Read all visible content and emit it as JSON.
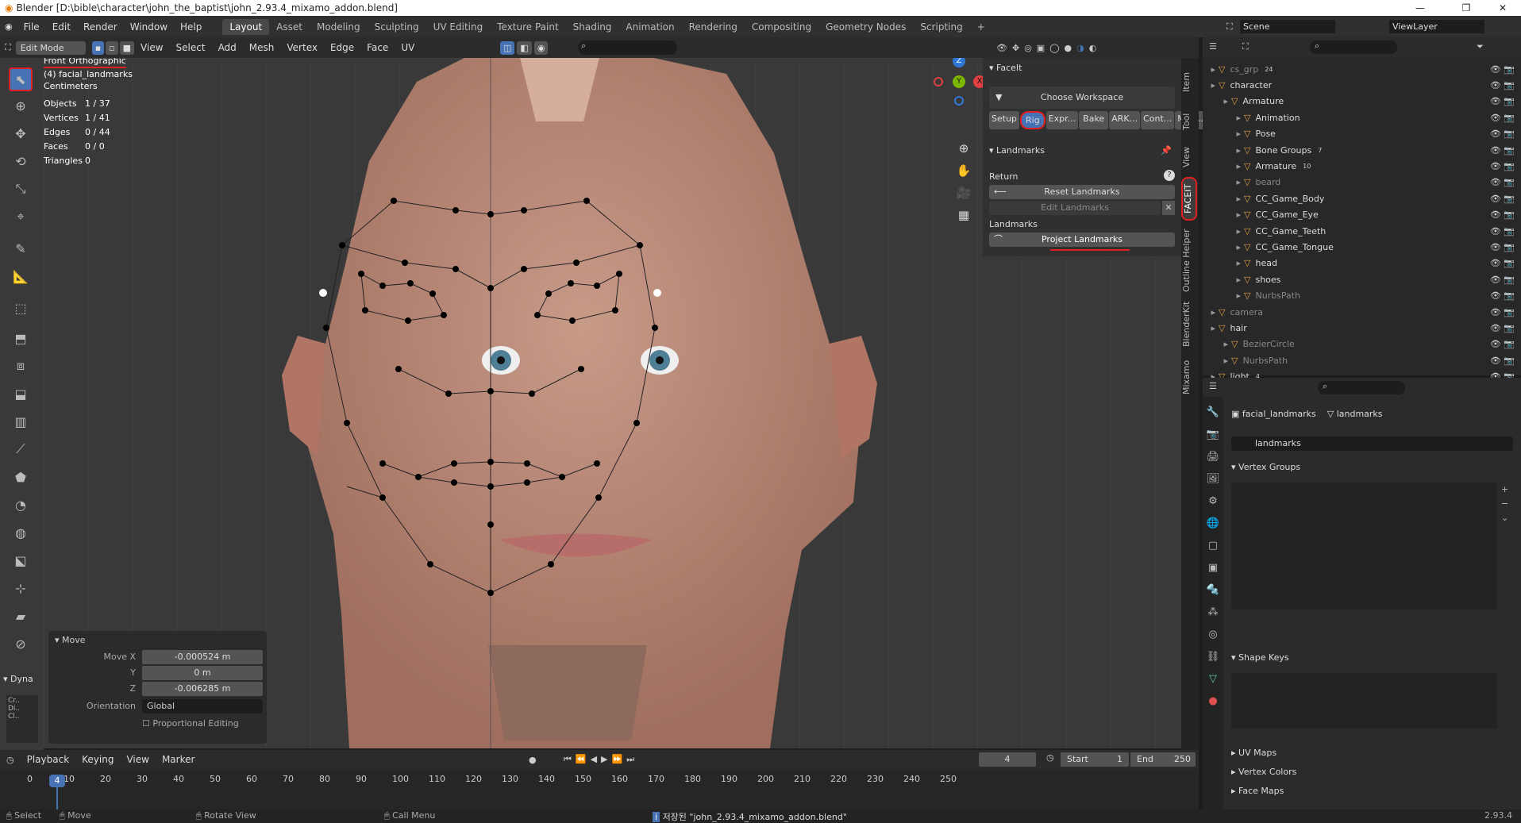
{
  "title": "Blender [D:\\bible\\character\\john_the_baptist\\john_2.93.4_mixamo_addon.blend]",
  "menus": [
    "File",
    "Edit",
    "Render",
    "Window",
    "Help"
  ],
  "workspaces": [
    "Layout",
    "Asset",
    "Modeling",
    "Sculpting",
    "UV Editing",
    "Texture Paint",
    "Shading",
    "Animation",
    "Rendering",
    "Compositing",
    "Geometry Nodes",
    "Scripting"
  ],
  "scene": "Scene",
  "view_layer": "ViewLayer",
  "header": {
    "mode": "Edit Mode",
    "view": "View",
    "select": "Select",
    "add": "Add",
    "mesh": "Mesh",
    "vertex": "Vertex",
    "edge": "Edge",
    "face": "Face",
    "uv": "UV"
  },
  "overlay": {
    "view_name": "Front Orthographic",
    "object": "(4) facial_landmarks",
    "units": "Centimeters",
    "stats": [
      [
        "Objects",
        "1 / 37"
      ],
      [
        "Vertices",
        "1 / 41"
      ],
      [
        "Edges",
        "0 / 44"
      ],
      [
        "Faces",
        "0 / 0"
      ],
      [
        "Triangles",
        "0"
      ]
    ]
  },
  "npanel": {
    "title": "FaceIt",
    "choose_workspace": "Choose Workspace",
    "tabs": [
      "Setup",
      "Rig",
      "Expr...",
      "Bake",
      "ARK...",
      "Cont...",
      "Moc..."
    ],
    "landmarks_title": "Landmarks",
    "return_label": "Return",
    "reset": "Reset Landmarks",
    "edit": "Edit Landmarks",
    "landmarks_label": "Landmarks",
    "project": "Project Landmarks"
  },
  "side_tabs": [
    "Item",
    "Tool",
    "View",
    "FACEIT",
    "Outline Helper",
    "BlenderKit",
    "Mixamo"
  ],
  "gizmo": {
    "z": "Z",
    "y": "Y",
    "x": "X"
  },
  "outliner": [
    {
      "name": "cs_grp",
      "indent": 0,
      "dim": true,
      "badge": "24"
    },
    {
      "name": "character",
      "indent": 0,
      "dim": false,
      "badge": ""
    },
    {
      "name": "Armature",
      "indent": 1,
      "dim": false,
      "badge": ""
    },
    {
      "name": "Animation",
      "indent": 2,
      "dim": false,
      "badge": ""
    },
    {
      "name": "Pose",
      "indent": 2,
      "dim": false,
      "badge": ""
    },
    {
      "name": "Bone Groups",
      "indent": 2,
      "dim": false,
      "badge": "7"
    },
    {
      "name": "Armature",
      "indent": 2,
      "dim": false,
      "badge": "10"
    },
    {
      "name": "beard",
      "indent": 2,
      "dim": true,
      "badge": ""
    },
    {
      "name": "CC_Game_Body",
      "indent": 2,
      "dim": false,
      "badge": ""
    },
    {
      "name": "CC_Game_Eye",
      "indent": 2,
      "dim": false,
      "badge": ""
    },
    {
      "name": "CC_Game_Teeth",
      "indent": 2,
      "dim": false,
      "badge": ""
    },
    {
      "name": "CC_Game_Tongue",
      "indent": 2,
      "dim": false,
      "badge": ""
    },
    {
      "name": "head",
      "indent": 2,
      "dim": false,
      "badge": ""
    },
    {
      "name": "shoes",
      "indent": 2,
      "dim": false,
      "badge": ""
    },
    {
      "name": "NurbsPath",
      "indent": 2,
      "dim": true,
      "badge": ""
    },
    {
      "name": "camera",
      "indent": 0,
      "dim": true,
      "badge": ""
    },
    {
      "name": "hair",
      "indent": 0,
      "dim": false,
      "badge": ""
    },
    {
      "name": "BezierCircle",
      "indent": 1,
      "dim": true,
      "badge": ""
    },
    {
      "name": "NurbsPath",
      "indent": 1,
      "dim": true,
      "badge": ""
    },
    {
      "name": "light",
      "indent": 0,
      "dim": false,
      "badge": "4"
    }
  ],
  "props": {
    "object": "facial_landmarks",
    "mesh": "landmarks",
    "data_name": "landmarks",
    "vertex_groups": "Vertex Groups",
    "shape_keys": "Shape Keys",
    "uv_maps": "UV Maps",
    "vertex_colors": "Vertex Colors",
    "face_maps": "Face Maps"
  },
  "move_panel": {
    "title": "Move",
    "move_x_label": "Move X",
    "move_x": "-0.000524 m",
    "y_label": "Y",
    "y": "0 m",
    "z_label": "Z",
    "z": "-0.006285 m",
    "orientation_label": "Orientation",
    "orientation": "Global",
    "proportional": "Proportional Editing"
  },
  "dyna": "Dyna",
  "timeline": {
    "playback": "Playback",
    "keying": "Keying",
    "view": "View",
    "marker": "Marker",
    "current": "4",
    "start_label": "Start",
    "start": "1",
    "end_label": "End",
    "end": "250",
    "ticks": [
      "0",
      "4",
      "10",
      "20",
      "30",
      "40",
      "50",
      "60",
      "70",
      "80",
      "90",
      "100",
      "110",
      "120",
      "130",
      "140",
      "150",
      "160",
      "170",
      "180",
      "190",
      "200",
      "210",
      "220",
      "230",
      "240",
      "250"
    ]
  },
  "status": {
    "select": "Select",
    "move": "Move",
    "rotate": "Rotate View",
    "call_menu": "Call Menu",
    "saved": "저장된 \"john_2.93.4_mixamo_addon.blend\"",
    "version": "2.93.4"
  },
  "colors": {
    "accent": "#4772b3",
    "red_annot": "#e02020",
    "bg": "#393939"
  }
}
